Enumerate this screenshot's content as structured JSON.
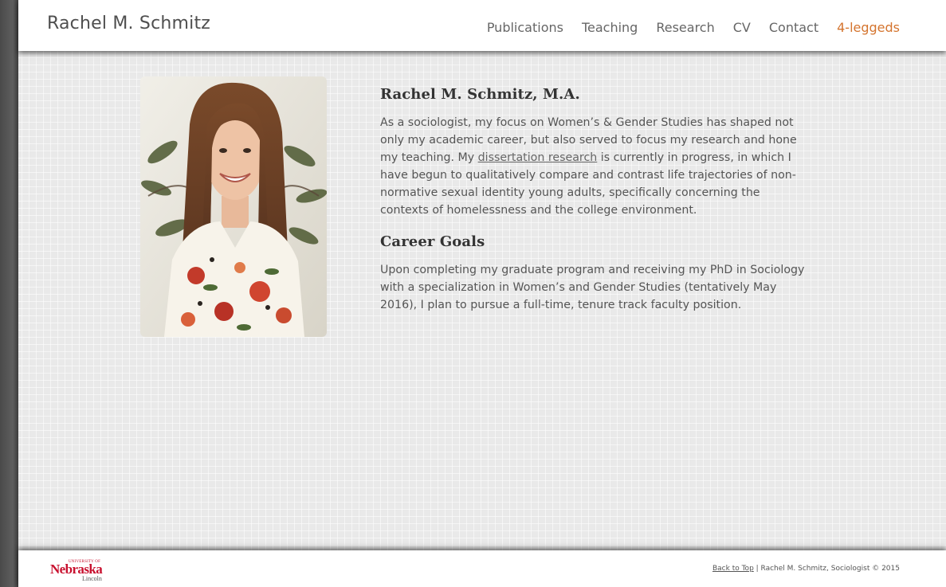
{
  "header": {
    "site_title": "Rachel M. Schmitz",
    "nav": [
      {
        "label": "Publications"
      },
      {
        "label": "Teaching"
      },
      {
        "label": "Research"
      },
      {
        "label": "CV"
      },
      {
        "label": "Contact"
      },
      {
        "label": "4-leggeds"
      }
    ]
  },
  "main": {
    "heading": "Rachel M. Schmitz, M.A.",
    "intro_text_before": "As a sociologist, my focus on Women’s & Gender Studies has shaped not only my academic career, but also served to focus my research and hone my teaching. My ",
    "intro_link": "dissertation research",
    "intro_text_after": " is currently in progress, in which I have begun to qualitatively compare and contrast life trajectories of non-normative sexual identity young adults, specifically concerning the contexts of homelessness and the college environment.",
    "goals_heading": "Career Goals",
    "goals_text": "Upon completing my graduate program and receiving my PhD in Sociology with a specialization in Women’s and Gender Studies (tentatively May 2016), I plan to pursue a full-time, tenure track faculty position."
  },
  "footer": {
    "logo_top": "UNIVERSITY OF",
    "logo_main": "Nebraska",
    "logo_bottom": "Lincoln",
    "back_to_top": "Back to Top",
    "credit": " | Rachel M. Schmitz, Sociologist © 2015"
  },
  "colors": {
    "accent_nav": "#d4742e",
    "unl_red": "#c8102e"
  }
}
